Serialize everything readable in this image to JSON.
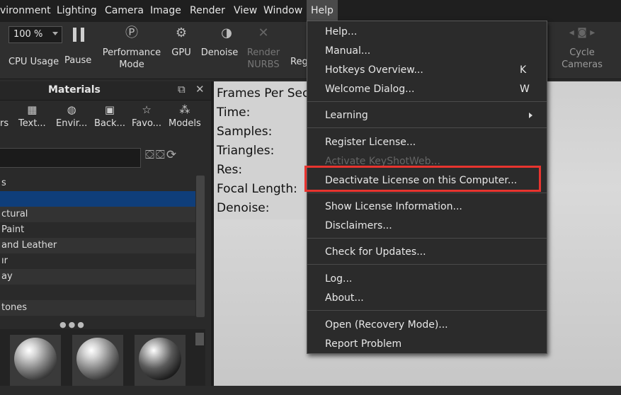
{
  "menubar": {
    "items": [
      "vironment",
      "Lighting",
      "Camera",
      "Image",
      "Render",
      "View",
      "Window",
      "Help"
    ]
  },
  "toolbar": {
    "zoom_value": "100 %",
    "cpu_usage": "CPU Usage",
    "pause": "Pause",
    "performance_mode_line1": "Performance",
    "performance_mode_line2": "Mode",
    "gpu": "GPU",
    "denoise": "Denoise",
    "render_nurbs_line1": "Render",
    "render_nurbs_line2": "NURBS",
    "region": "Reg",
    "cycle_cameras_line1": "Cycle",
    "cycle_cameras_line2": "Cameras"
  },
  "materials_panel": {
    "title": "Materials",
    "tabs": [
      "rs",
      "Text...",
      "Envir...",
      "Back...",
      "Favo...",
      "Models"
    ],
    "tree_items": [
      "s",
      "",
      "ctural",
      "Paint",
      "and Leather",
      "ır",
      "ay",
      "",
      "tones"
    ]
  },
  "viewport": {
    "hud_lines": [
      "Frames Per Sec",
      "Time:",
      "Samples:",
      "Triangles:",
      "Res:",
      "Focal Length:",
      "Denoise:"
    ]
  },
  "help_menu": {
    "items": [
      {
        "label": "Help...",
        "shortcut": ""
      },
      {
        "label": "Manual...",
        "shortcut": ""
      },
      {
        "label": "Hotkeys Overview...",
        "shortcut": "K"
      },
      {
        "label": "Welcome Dialog...",
        "shortcut": "W"
      },
      {
        "label": "Learning",
        "shortcut": ""
      },
      {
        "label": "Register License...",
        "shortcut": ""
      },
      {
        "label": "Activate KeyShotWeb...",
        "shortcut": ""
      },
      {
        "label": "Deactivate License on this Computer...",
        "shortcut": ""
      },
      {
        "label": "Show License Information...",
        "shortcut": ""
      },
      {
        "label": "Disclaimers...",
        "shortcut": ""
      },
      {
        "label": "Check for Updates...",
        "shortcut": ""
      },
      {
        "label": "Log...",
        "shortcut": ""
      },
      {
        "label": "About...",
        "shortcut": ""
      },
      {
        "label": "Open (Recovery Mode)...",
        "shortcut": ""
      },
      {
        "label": "Report Problem",
        "shortcut": ""
      }
    ]
  },
  "colors": {
    "highlight": "#e8342f",
    "selected_row": "#0f3e7a"
  }
}
